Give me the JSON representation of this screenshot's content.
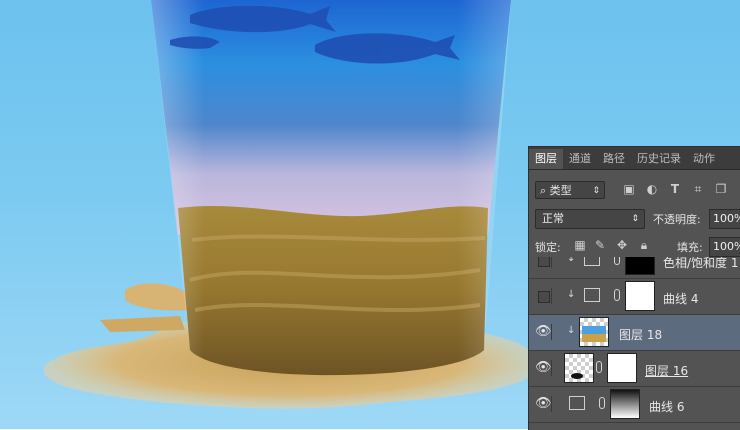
{
  "layers_panel": {
    "tabs": [
      "图层",
      "通道",
      "路径",
      "历史记录",
      "动作"
    ],
    "active_tab": "图层",
    "filter_label": "类型",
    "filter_icons": [
      "image-filter-icon",
      "adjustment-filter-icon",
      "type-filter-icon",
      "shape-filter-icon",
      "smart-object-filter-icon"
    ],
    "blend_mode": "正常",
    "opacity_label": "不透明度:",
    "opacity_value": "100%",
    "lock_label": "锁定:",
    "lock_icons": [
      "lock-transparent-icon",
      "lock-image-icon",
      "lock-position-icon",
      "lock-all-icon"
    ],
    "fill_label": "填充:",
    "fill_value": "100%",
    "layers": [
      {
        "name": "色相/饱和度 1",
        "visible": false,
        "type": "adjustment",
        "clipped": true
      },
      {
        "name": "曲线 4",
        "visible": false,
        "type": "adjustment",
        "clipped": true
      },
      {
        "name": "图层 18",
        "visible": true,
        "type": "pixel",
        "clipped": true,
        "selected": true
      },
      {
        "name": "图层 16",
        "visible": true,
        "type": "pixel",
        "clipped": false
      },
      {
        "name": "曲线 6",
        "visible": true,
        "type": "adjustment",
        "clipped": false
      }
    ]
  },
  "colors": {
    "panel_bg": "#535353",
    "tab_bar_bg": "#3c3c3c",
    "selected_row": "#5d6b7e",
    "canvas_sky": "#7ccaf1"
  }
}
